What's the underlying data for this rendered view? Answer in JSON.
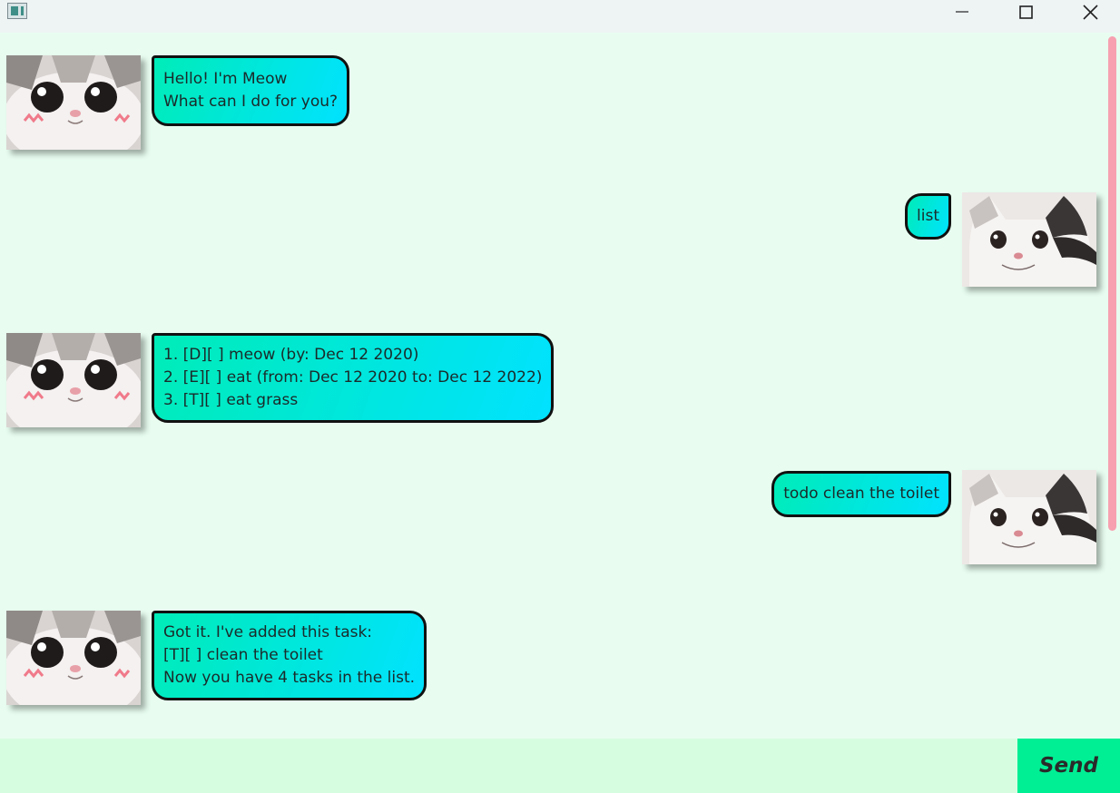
{
  "window": {
    "app_icon": "app-window-icon",
    "controls": {
      "minimize": "minimize-icon",
      "maximize": "maximize-icon",
      "close": "close-icon"
    }
  },
  "messages": [
    {
      "sender": "bot",
      "lines": [
        "Hello! I'm Meow",
        "What can I do for you?"
      ]
    },
    {
      "sender": "user",
      "lines": [
        "list"
      ]
    },
    {
      "sender": "bot",
      "lines": [
        "1. [D][ ] meow (by: Dec 12 2020)",
        "2. [E][ ] eat (from: Dec 12 2020 to: Dec 12 2022)",
        "3. [T][ ] eat grass"
      ]
    },
    {
      "sender": "user",
      "lines": [
        "todo clean the toilet"
      ]
    },
    {
      "sender": "bot",
      "lines": [
        "Got it. I've added this task:",
        "[T][ ] clean the toilet",
        "Now you have 4 tasks in the list."
      ]
    }
  ],
  "input": {
    "value": "",
    "placeholder": ""
  },
  "send_button": {
    "label": "Send"
  },
  "colors": {
    "background": "#e8fdf0",
    "bubble_gradient_start": "#00ecb8",
    "bubble_gradient_end": "#00e2ff",
    "scrollbar": "#f7a0b0",
    "input_bar": "#d7fde0",
    "send_button": "#00ef94"
  },
  "avatars": {
    "bot": "white-kitten-avatar",
    "user": "black-white-cat-avatar"
  }
}
